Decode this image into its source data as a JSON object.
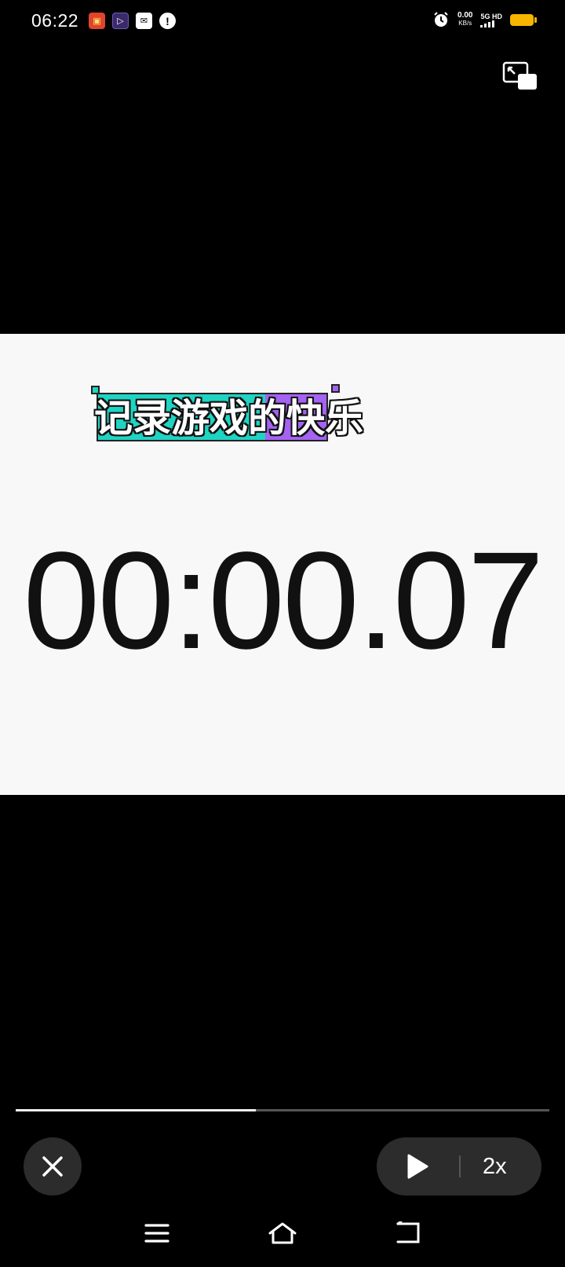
{
  "status_bar": {
    "time": "06:22",
    "notifications": [
      "app-notification-icon",
      "video-app-icon",
      "mail-icon",
      "alert-icon"
    ],
    "network_speed": "0.00",
    "network_speed_unit": "KB/s",
    "network_type": "5G HD",
    "battery_color": "#f7b500"
  },
  "video": {
    "caption": "记录游戏的快乐",
    "stopwatch_time": "00:00.07",
    "caption_colors": [
      "#1fd4c3",
      "#a463f2"
    ]
  },
  "player": {
    "progress_fraction": 0.45,
    "speed_label": "2x"
  },
  "nav_bar": {
    "items": [
      "menu-icon",
      "home-icon",
      "back-icon"
    ]
  }
}
